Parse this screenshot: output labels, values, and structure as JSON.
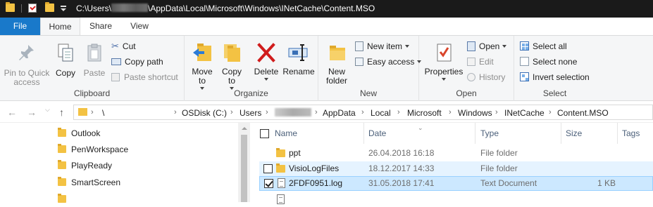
{
  "titlebar": {
    "path_prefix": "C:\\Users\\",
    "path_suffix": "\\AppData\\Local\\Microsoft\\Windows\\INetCache\\Content.MSO"
  },
  "tabs": {
    "file": "File",
    "home": "Home",
    "share": "Share",
    "view": "View"
  },
  "ribbon": {
    "clipboard": {
      "label": "Clipboard",
      "pin": "Pin to Quick access",
      "copy": "Copy",
      "paste": "Paste",
      "cut": "Cut",
      "copy_path": "Copy path",
      "paste_shortcut": "Paste shortcut"
    },
    "organize": {
      "label": "Organize",
      "move_to": "Move to",
      "copy_to": "Copy to",
      "delete": "Delete",
      "rename": "Rename"
    },
    "new": {
      "label": "New",
      "new_folder": "New folder",
      "new_item": "New item",
      "easy_access": "Easy access"
    },
    "open": {
      "label": "Open",
      "properties": "Properties",
      "open": "Open",
      "edit": "Edit",
      "history": "History"
    },
    "select": {
      "label": "Select",
      "select_all": "Select all",
      "select_none": "Select none",
      "invert": "Invert selection"
    }
  },
  "address": {
    "crumbs": [
      "\\",
      "OSDisk (C:)",
      "Users",
      "AppData",
      "Local",
      "Microsoft",
      "Windows",
      "INetCache",
      "Content.MSO"
    ]
  },
  "nav_items": [
    "Outlook",
    "PenWorkspace",
    "PlayReady",
    "SmartScreen"
  ],
  "columns": {
    "name": "Name",
    "date": "Date",
    "type": "Type",
    "size": "Size",
    "tags": "Tags"
  },
  "files": [
    {
      "name": "ppt",
      "date": "26.04.2018 16:18",
      "type": "File folder",
      "size": ""
    },
    {
      "name": "VisioLogFiles",
      "date": "18.12.2017 14:33",
      "type": "File folder",
      "size": ""
    },
    {
      "name": "2FDF0951.log",
      "date": "31.05.2018 17:41",
      "type": "Text Document",
      "size": "1 KB"
    }
  ],
  "colors": {
    "accent": "#1979ca",
    "selection": "#cce8ff",
    "hover": "#e5f3ff",
    "folder": "#f3c243"
  }
}
